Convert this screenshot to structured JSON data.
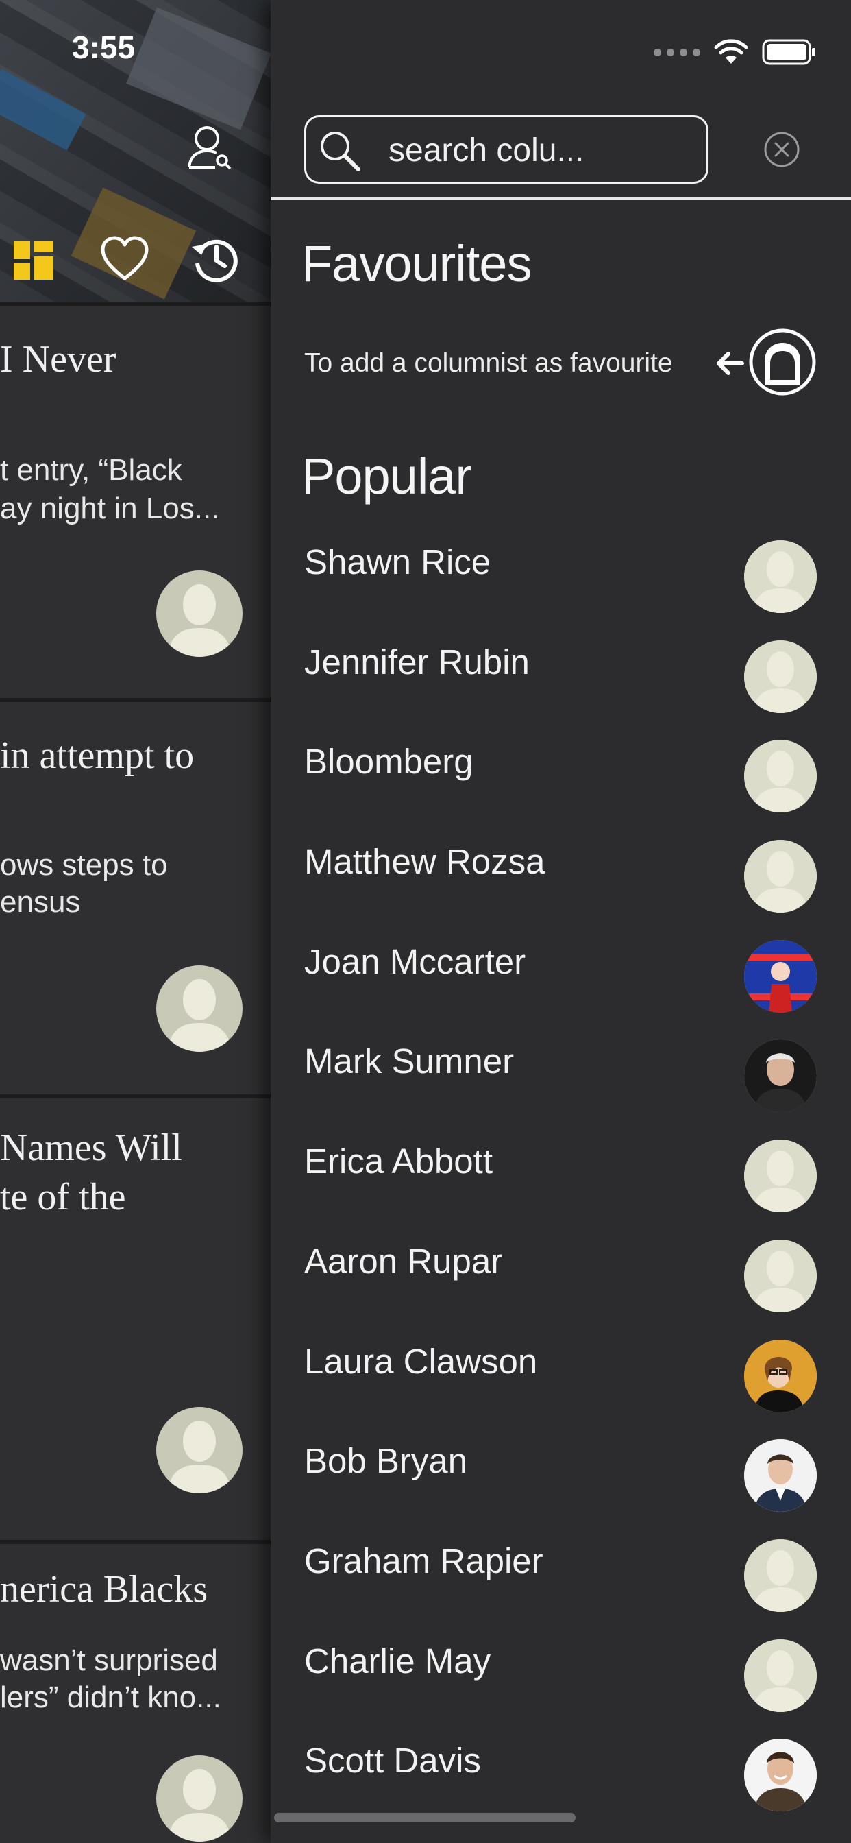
{
  "status_bar": {
    "time": "3:55"
  },
  "feed": {
    "cards": [
      {
        "title_lines": [
          "I Never"
        ],
        "text_lines": [
          "t entry, “Black",
          "ay night in Los..."
        ],
        "avatar": "default-avatar-icon"
      },
      {
        "title_lines": [
          " in attempt to"
        ],
        "text_lines": [
          "ows steps to",
          "ensus"
        ],
        "avatar": "default-avatar-icon"
      },
      {
        "title_lines": [
          "Names Will",
          "te of the"
        ],
        "text_lines": [],
        "avatar": "default-avatar-icon"
      },
      {
        "title_lines": [
          "nerica Blacks"
        ],
        "text_lines": [
          "wasn’t surprised",
          "lers” didn’t kno..."
        ],
        "avatar": "default-avatar-icon"
      }
    ]
  },
  "drawer": {
    "search": {
      "placeholder": "search colu..."
    },
    "favourites": {
      "title": "Favourites",
      "hint": "To add a columnist as favourite"
    },
    "popular": {
      "title": "Popular",
      "items": [
        {
          "name": "Shawn Rice",
          "avatar": "default"
        },
        {
          "name": "Jennifer Rubin",
          "avatar": "default"
        },
        {
          "name": "Bloomberg",
          "avatar": "default"
        },
        {
          "name": "Matthew Rozsa",
          "avatar": "default"
        },
        {
          "name": "Joan Mccarter",
          "avatar": "photo-blue-girl"
        },
        {
          "name": "Mark Sumner",
          "avatar": "photo-man-grey-hair"
        },
        {
          "name": "Erica Abbott",
          "avatar": "default"
        },
        {
          "name": "Aaron Rupar",
          "avatar": "default"
        },
        {
          "name": "Laura Clawson",
          "avatar": "photo-woman-glasses"
        },
        {
          "name": "Bob Bryan",
          "avatar": "photo-man-suit"
        },
        {
          "name": "Graham Rapier",
          "avatar": "default"
        },
        {
          "name": "Charlie May",
          "avatar": "default"
        },
        {
          "name": "Scott Davis",
          "avatar": "photo-man-smiling"
        }
      ]
    }
  },
  "colors": {
    "background": "#2b2b2d",
    "drawer": "#2c2c2e",
    "accent_yellow": "#f3c81a",
    "default_avatar_bg": "#c9c9b7",
    "default_avatar_figure": "#ecebdc"
  }
}
